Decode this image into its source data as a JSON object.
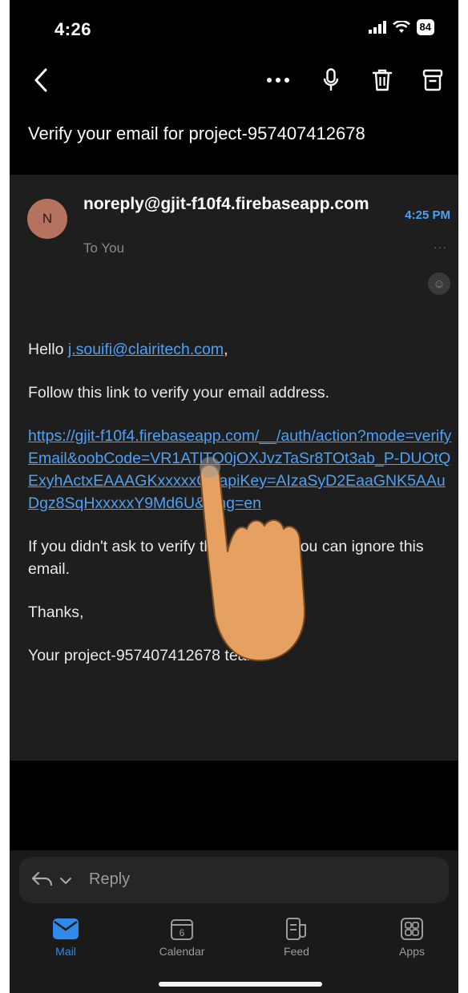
{
  "status_bar": {
    "time": "4:26",
    "battery": "84",
    "icons": [
      "cellular-signal-icon",
      "wifi-icon",
      "battery-icon"
    ]
  },
  "toolbar": {
    "icons": [
      "back-chevron-icon",
      "more-icon",
      "microphone-icon",
      "trash-icon",
      "archive-icon"
    ]
  },
  "subject": "Verify your email for project-957407412678",
  "message": {
    "avatar_initial": "N",
    "sender": "noreply@gjit-f10f4.firebaseapp.com",
    "to": "To You",
    "time": "4:25 PM",
    "more": "···",
    "react_icon": "emoji-reaction-icon",
    "greeting_prefix": "Hello ",
    "greeting_email": "j.souifi@clairitech.com",
    "greeting_suffix": ",",
    "instruction": "Follow this link to verify your email address.",
    "link": "https://gjit-f10f4.firebaseapp.com/__/auth/action?mode=verifyEmail&oobCode=VR1ATlTO0jOXJvzTaSr8TOt3ab_P-DUOtQExyhActxEAAAGKxxxxxQ&apiKey=AIzaSyD2EaaGNK5AAuDgz8SqHxxxxxY9Md6U&lang=en",
    "ignore_text": "If you didn't ask to verify this address, you can ignore this email.",
    "thanks": "Thanks,",
    "signature": "Your project-957407412678 team"
  },
  "reply_bar": {
    "label": "Reply",
    "icons": [
      "reply-arrow-icon",
      "chevron-down-icon"
    ]
  },
  "tabs": [
    {
      "label": "Mail",
      "icon": "mail-icon",
      "active": true
    },
    {
      "label": "Calendar",
      "icon": "calendar-icon",
      "day": "6"
    },
    {
      "label": "Feed",
      "icon": "feed-icon"
    },
    {
      "label": "Apps",
      "icon": "apps-icon"
    }
  ],
  "colors": {
    "accent": "#4ea1f3",
    "tab_active": "#2f8be9",
    "card": "#1e1e1e",
    "avatar": "#b5735f"
  }
}
